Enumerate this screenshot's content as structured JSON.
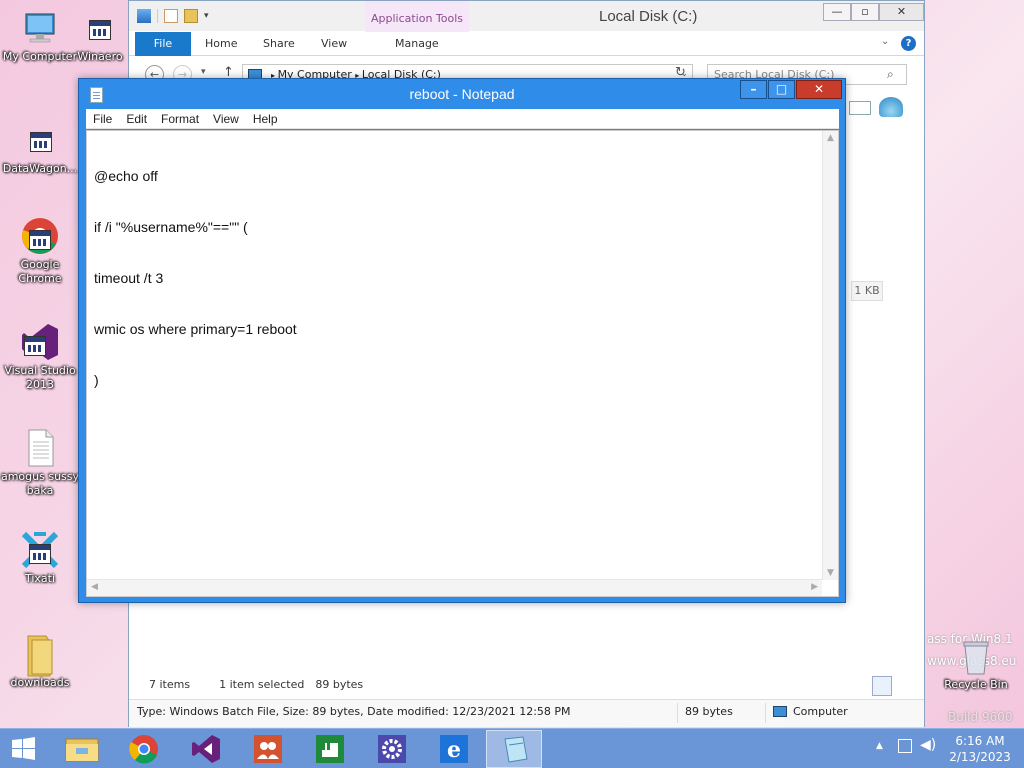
{
  "desktop": {
    "icons": [
      {
        "label": "My Computer"
      },
      {
        "label": "Winaero"
      },
      {
        "label": "DataWagon..."
      },
      {
        "label": "Google Chrome"
      },
      {
        "label": "Visual Studio 2013"
      },
      {
        "label": "amogus sussy baka"
      },
      {
        "label": "Tixati"
      },
      {
        "label": "downloads"
      },
      {
        "label": "Recycle Bin"
      }
    ],
    "watermark": {
      "line1": "ass for Win8.1",
      "line2": "www.glass8.eu",
      "line3": "Build 9600"
    }
  },
  "explorer": {
    "title": "Local Disk (C:)",
    "contextual_tab": "Application Tools",
    "tabs": {
      "file": "File",
      "home": "Home",
      "share": "Share",
      "view": "View",
      "manage": "Manage"
    },
    "breadcrumb": {
      "root": "My Computer",
      "current": "Local Disk (C:)"
    },
    "search_placeholder": "Search Local Disk (C:)",
    "file_size_cell": "1 KB",
    "status": {
      "items": "7 items",
      "selected": "1 item selected",
      "size": "89 bytes"
    },
    "details": {
      "info": "Type: Windows Batch File, Size: 89 bytes, Date modified: 12/23/2021 12:58 PM",
      "size": "89 bytes",
      "location": "Computer"
    }
  },
  "notepad": {
    "title": "reboot - Notepad",
    "menu": {
      "file": "File",
      "edit": "Edit",
      "format": "Format",
      "view": "View",
      "help": "Help"
    },
    "lines": [
      "@echo off",
      "if /i \"%username%\"==\"\" (",
      "timeout /t 3",
      "wmic os where primary=1 reboot",
      ")"
    ]
  },
  "taskbar": {
    "clock_time": "6:16 AM",
    "clock_date": "2/13/2023"
  }
}
